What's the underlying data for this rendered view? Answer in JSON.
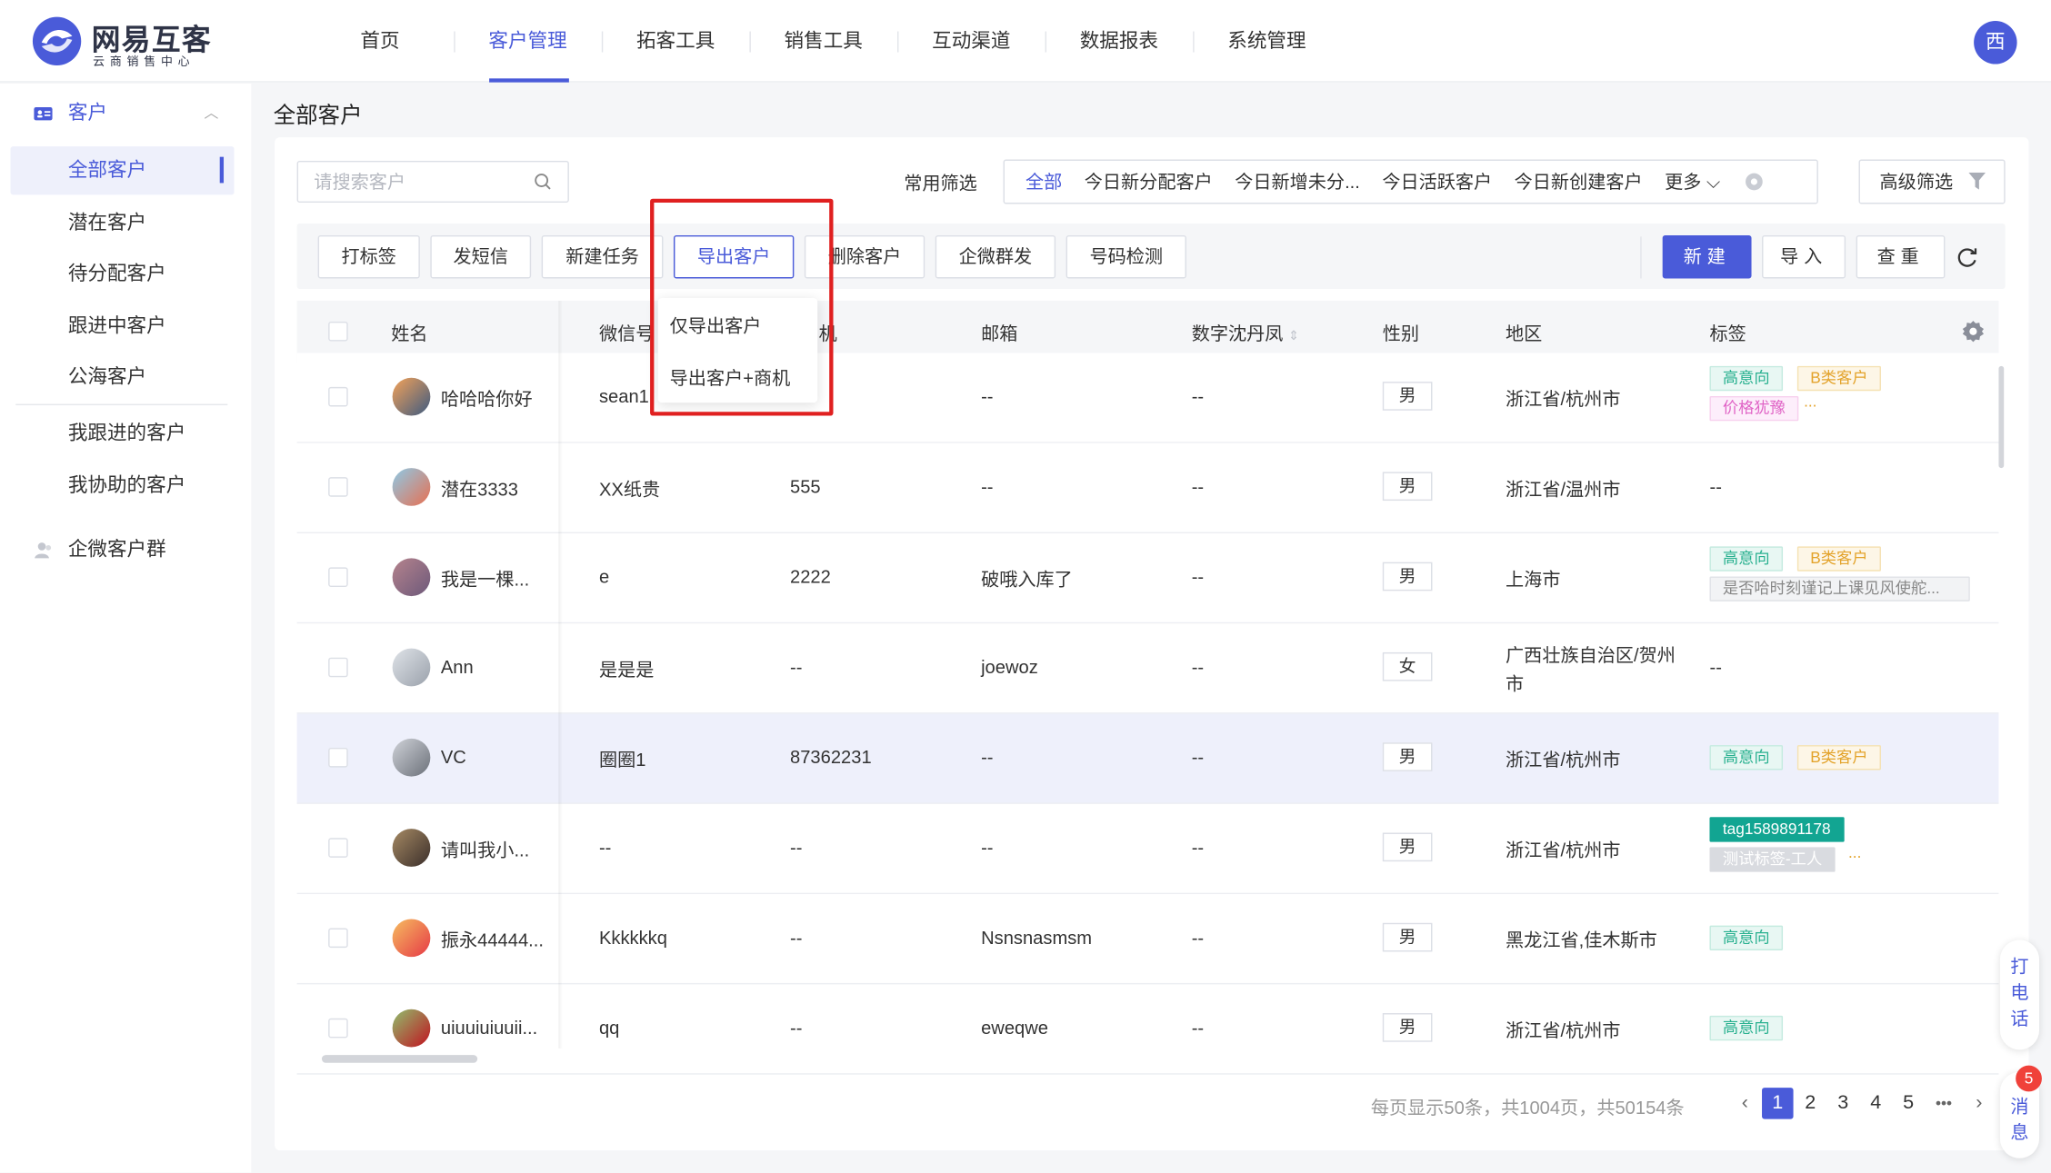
{
  "brand": {
    "title": "网易互客",
    "subtitle": "云商销售中心"
  },
  "nav": [
    {
      "label": "首页",
      "active": false
    },
    {
      "label": "客户管理",
      "active": true
    },
    {
      "label": "拓客工具",
      "active": false
    },
    {
      "label": "销售工具",
      "active": false
    },
    {
      "label": "互动渠道",
      "active": false
    },
    {
      "label": "数据报表",
      "active": false
    },
    {
      "label": "系统管理",
      "active": false
    }
  ],
  "user": {
    "avatar_text": "西"
  },
  "sidebar": {
    "group_customers": "客户",
    "items": [
      "全部客户",
      "潜在客户",
      "待分配客户",
      "跟进中客户",
      "公海客户"
    ],
    "items2": [
      "我跟进的客户",
      "我协助的客户"
    ],
    "group_wecom": "企微客户群"
  },
  "page_title": "全部客户",
  "search": {
    "placeholder": "请搜索客户"
  },
  "filters": {
    "label": "常用筛选",
    "chips": [
      "全部",
      "今日新分配客户",
      "今日新增未分...",
      "今日活跃客户",
      "今日新创建客户"
    ],
    "more": "更多",
    "advanced": "高级筛选"
  },
  "toolbar": {
    "tag": "打标签",
    "sms": "发短信",
    "task": "新建任务",
    "export": "导出客户",
    "delete": "删除客户",
    "wecom_mass": "企微群发",
    "number_check": "号码检测",
    "new": "新建",
    "import": "导入",
    "dedupe": "查重"
  },
  "export_menu": [
    "仅导出客户",
    "导出客户+商机"
  ],
  "columns": {
    "name": "姓名",
    "wechat": "微信号",
    "phone_partial": "机",
    "email": "邮箱",
    "digital": "数字沈丹凤",
    "gender": "性别",
    "region": "地区",
    "tags": "标签"
  },
  "rows": [
    {
      "name": "哈哈哈你好",
      "wechat": "sean1",
      "phone": "",
      "email": "--",
      "digital": "--",
      "gender": "男",
      "region": "浙江省/杭州市",
      "region2": "",
      "tags": [
        [
          "高意向",
          "green"
        ],
        [
          "B类客户",
          "orange"
        ]
      ],
      "tags2": [
        [
          "价格犹豫",
          "pink"
        ]
      ],
      "more": "...",
      "none": ""
    },
    {
      "name": "潜在3333",
      "wechat": "XX纸贵",
      "phone": "555",
      "email": "--",
      "digital": "--",
      "gender": "男",
      "region": "浙江省/温州市",
      "region2": "",
      "tags": [],
      "tags2": [],
      "more": "",
      "none": "--"
    },
    {
      "name": "我是一棵...",
      "wechat": "e",
      "phone": "2222",
      "email": "破哦入库了",
      "digital": "--",
      "gender": "男",
      "region": "上海市",
      "region2": "",
      "tags": [
        [
          "高意向",
          "green"
        ],
        [
          "B类客户",
          "orange"
        ]
      ],
      "tags2": [
        [
          "是否哈时刻谨记上课见风使舵...",
          "grey"
        ]
      ],
      "more": "",
      "none": ""
    },
    {
      "name": "Ann",
      "wechat": "是是是",
      "phone": "--",
      "email": "joewoz",
      "digital": "--",
      "gender": "女",
      "region": "广西壮族自治区/贺州",
      "region2": "市",
      "tags": [],
      "tags2": [],
      "more": "",
      "none": "--"
    },
    {
      "name": "VC",
      "wechat": "圈圈1",
      "phone": "87362231",
      "email": "--",
      "digital": "--",
      "gender": "男",
      "region": "浙江省/杭州市",
      "region2": "",
      "tags": [
        [
          "高意向",
          "green"
        ],
        [
          "B类客户",
          "orange"
        ]
      ],
      "tags2": [],
      "more": "",
      "none": ""
    },
    {
      "name": "请叫我小...",
      "wechat": "--",
      "phone": "--",
      "email": "--",
      "digital": "--",
      "gender": "男",
      "region": "浙江省/杭州市",
      "region2": "",
      "tags": [
        [
          "tag1589891178",
          "teal"
        ]
      ],
      "tags2": [
        [
          "测试标签-工人",
          "greyfill"
        ]
      ],
      "more": "...",
      "none": ""
    },
    {
      "name": "振永44444...",
      "wechat": "Kkkkkkq",
      "phone": "--",
      "email": "Nsnsnasmsm",
      "digital": "--",
      "gender": "男",
      "region": "黑龙江省,佳木斯市",
      "region2": "",
      "tags": [
        [
          "高意向",
          "green"
        ]
      ],
      "tags2": [],
      "more": "",
      "none": ""
    },
    {
      "name": "uiuuiuiuuii...",
      "wechat": "qq",
      "phone": "--",
      "email": "eweqwe",
      "digital": "--",
      "gender": "男",
      "region": "浙江省/杭州市",
      "region2": "",
      "tags": [
        [
          "高意向",
          "green"
        ]
      ],
      "tags2": [],
      "more": "",
      "none": ""
    }
  ],
  "pagination": {
    "info": "每页显示50条，共1004页，共50154条",
    "pages": [
      "1",
      "2",
      "3",
      "4",
      "5"
    ],
    "current": "1",
    "ellipsis": "•••"
  },
  "float": {
    "call": "打电话",
    "msg": "消息",
    "badge": "5"
  },
  "colors": {
    "accent": "#4a5bd9",
    "highlight_box": "#e02020"
  }
}
